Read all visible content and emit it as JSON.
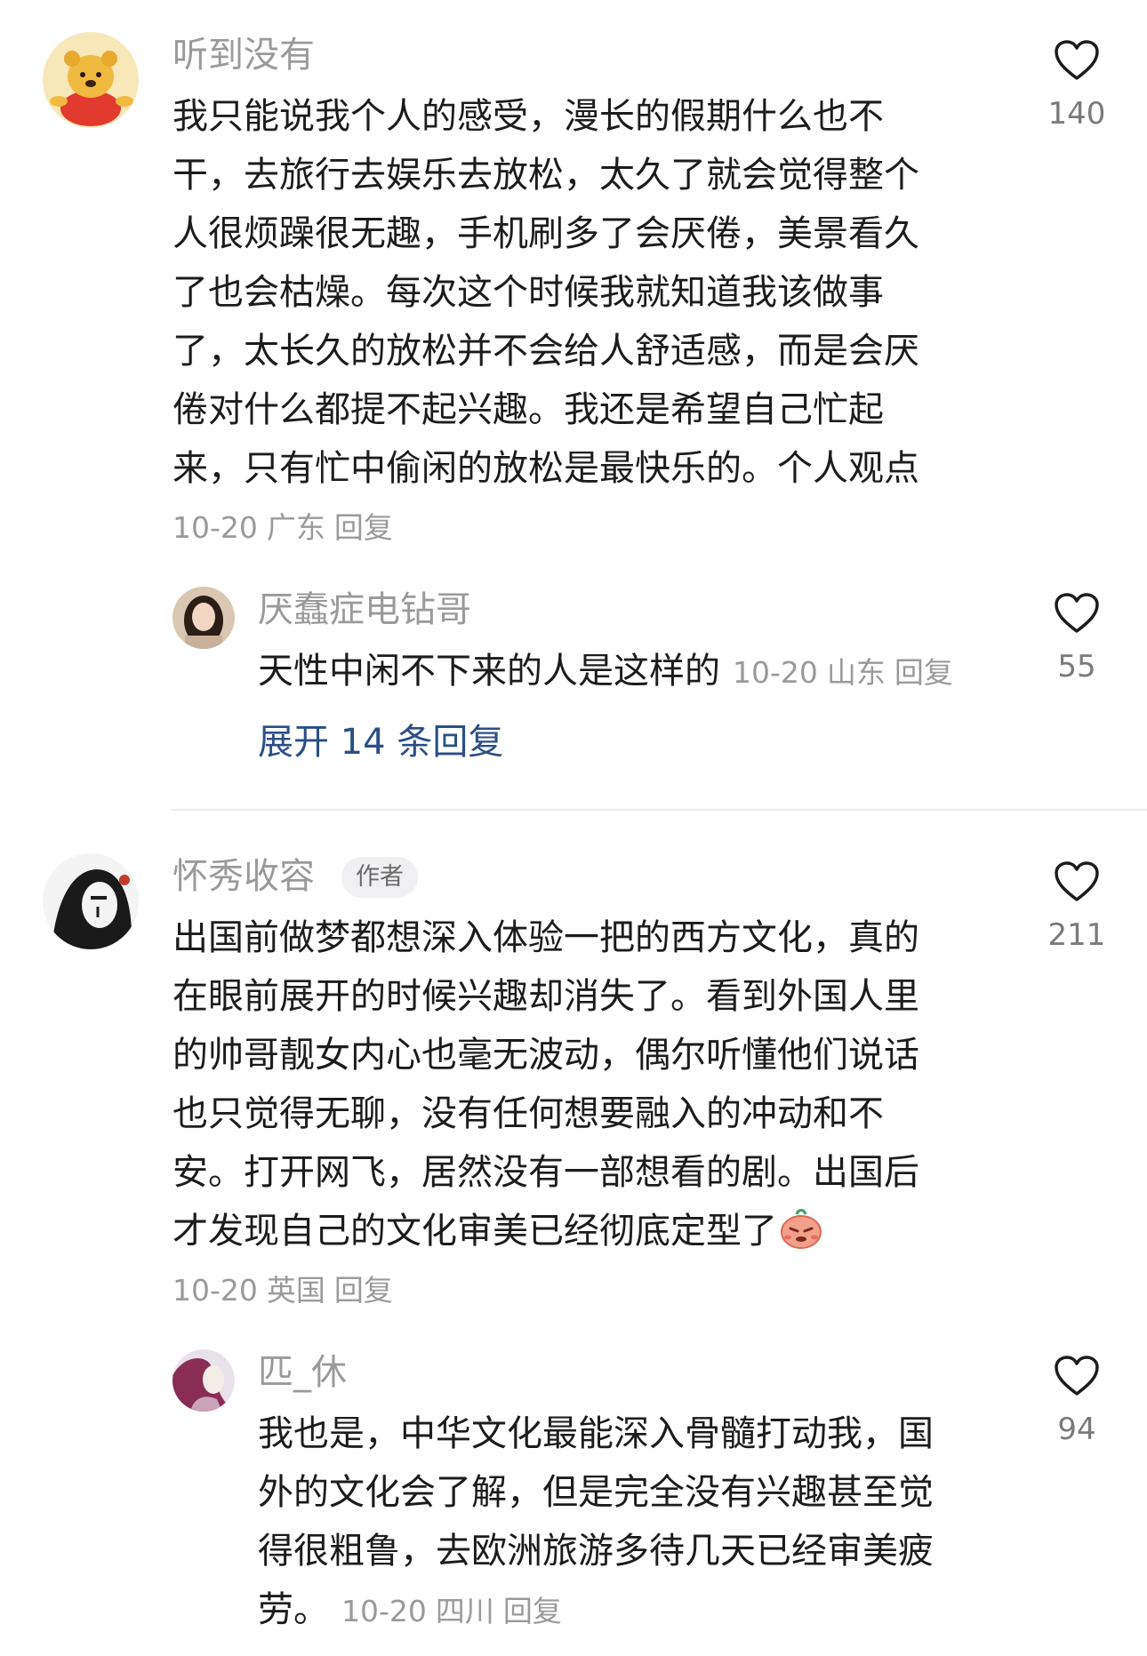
{
  "comments": [
    {
      "username": "听到没有",
      "body_lines": [
        "我只能说我个人的感受，漫长的假期什么也不",
        "干，去旅行去娱乐去放松，太久了就会觉得整个",
        "人很烦躁很无趣，手机刷多了会厌倦，美景看久",
        "了也会枯燥。每次这个时候我就知道我该做事",
        "了，太长久的放松并不会给人舒适感，而是会厌",
        "倦对什么都提不起兴趣。我还是希望自己忙起",
        "来，只有忙中偷闲的放松是最快乐的。个人观点"
      ],
      "date": "10-20",
      "location": "广东",
      "reply_label": "回复",
      "likes": "140",
      "avatar_icon": "winnie-the-pooh-avatar",
      "replies": [
        {
          "username": "厌蠢症电钻哥",
          "body": "天性中闲不下来的人是这样的",
          "date": "10-20",
          "location": "山东",
          "reply_label": "回复",
          "likes": "55",
          "avatar_icon": "girl-photo-avatar"
        }
      ],
      "expand_label": "展开 14 条回复"
    },
    {
      "username": "怀秀收容",
      "badge": "作者",
      "body_lines": [
        "出国前做梦都想深入体验一把的西方文化，真的",
        "在眼前展开的时候兴趣却消失了。看到外国人里",
        "的帅哥靓女内心也毫无波动，偶尔听懂他们说话",
        "也只觉得无聊，没有任何想要融入的冲动和不",
        "安。打开网飞，居然没有一部想看的剧。出国后",
        "才发现自己的文化审美已经彻底定型了"
      ],
      "emoji": "shy-face-emoji",
      "date": "10-20",
      "location": "英国",
      "reply_label": "回复",
      "likes": "211",
      "avatar_icon": "sketch-portrait-avatar",
      "replies": [
        {
          "username": "匹_休",
          "body_lines": [
            "我也是，中华文化最能深入骨髓打动我，国",
            "外的文化会了解，但是完全没有兴趣甚至觉",
            "得很粗鲁，去欧洲旅游多待几天已经审美疲",
            "劳。"
          ],
          "date": "10-20",
          "location": "四川",
          "reply_label": "回复",
          "likes": "94",
          "avatar_icon": "illustration-avatar"
        }
      ]
    }
  ],
  "colors": {
    "username": "#9a9a9a",
    "text": "#1c1c1c",
    "link": "#2b4f86",
    "badge_bg": "#f0f0f2"
  }
}
